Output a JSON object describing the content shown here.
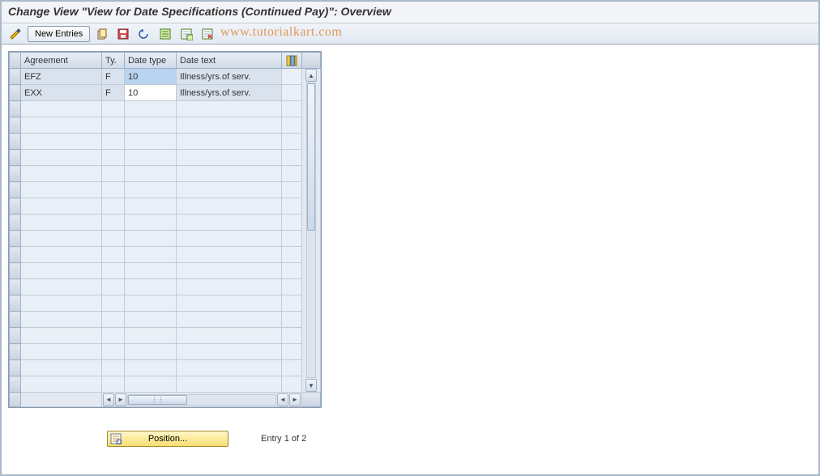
{
  "title": "Change View \"View for Date Specifications (Continued Pay)\": Overview",
  "watermark": "www.tutorialkart.com",
  "toolbar": {
    "new_entries_label": "New Entries"
  },
  "grid": {
    "headers": {
      "agreement": "Agreement",
      "ty": "Ty.",
      "date_type": "Date type",
      "date_text": "Date text"
    },
    "rows": [
      {
        "agreement": "EFZ",
        "ty": "F",
        "date_type": "10",
        "date_text": "Illness/yrs.of serv.",
        "selected": true
      },
      {
        "agreement": "EXX",
        "ty": "F",
        "date_type": "10",
        "date_text": "Illness/yrs.of serv.",
        "selected": false
      }
    ],
    "empty_row_count": 18
  },
  "footer": {
    "position_label": "Position...",
    "entry_text": "Entry 1 of 2"
  }
}
